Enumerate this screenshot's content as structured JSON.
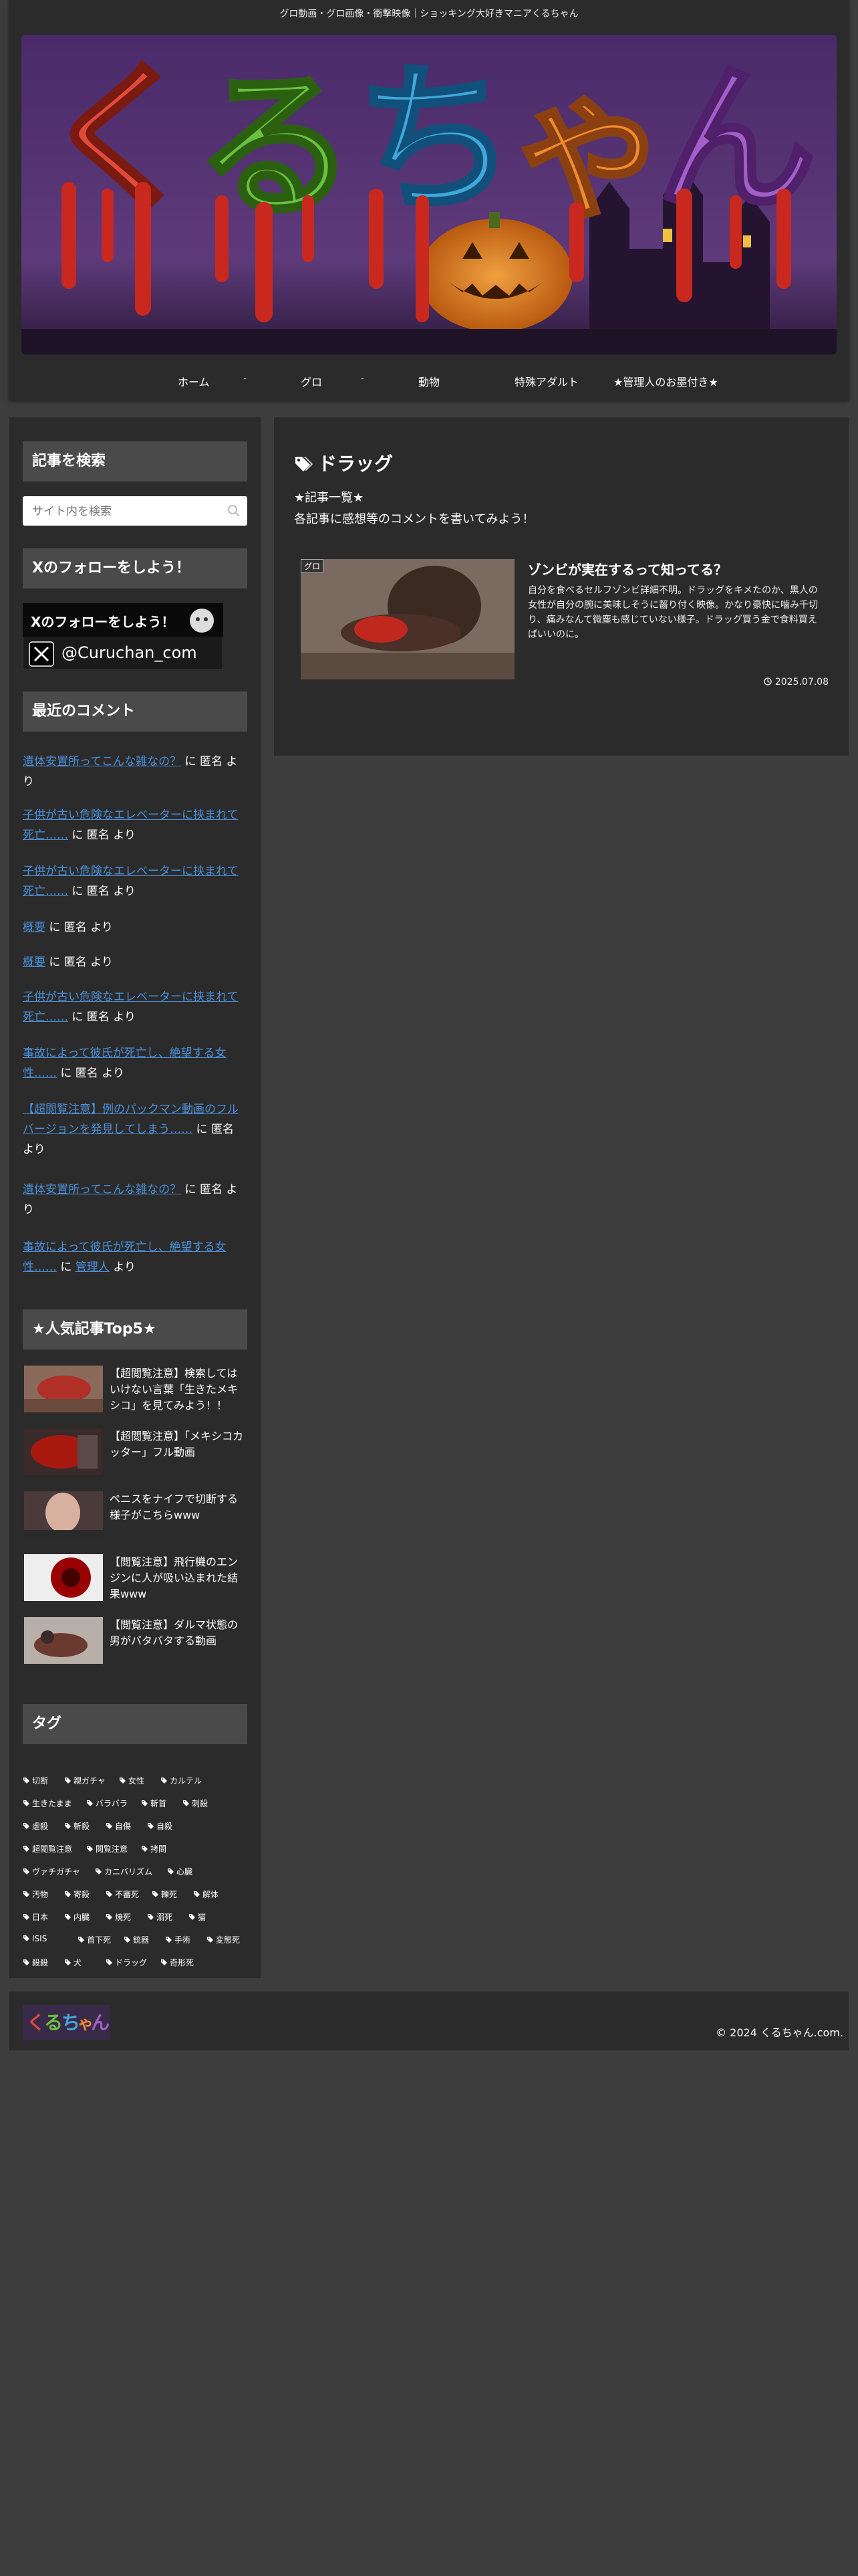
{
  "header": {
    "tagline": "グロ動画・グロ画像・衝撃映像｜ショッキング大好きマニアくるちゃん",
    "logo_text": "くるちゃん",
    "nav": [
      {
        "label": "ホーム"
      },
      {
        "label": "グロ"
      },
      {
        "label": "動物"
      },
      {
        "label": "特殊アダルト"
      },
      {
        "label": "★管理人のお墨付き★"
      }
    ],
    "nav_separator": "-"
  },
  "sidebar": {
    "search": {
      "title": "記事を検索",
      "placeholder": "サイト内を検索"
    },
    "follow": {
      "title": "Xのフォローをしよう！",
      "banner_heading": "Xのフォローをしよう！",
      "banner_handle": "@Curuchan_com"
    },
    "recent_comments": {
      "title": "最近のコメント",
      "items": [
        {
          "link": "遺体安置所ってこんな雑なの？",
          "by": " に 匿名 より",
          "author_link": ""
        },
        {
          "link": "子供が古い危険なエレベーターに挟まれて死亡……",
          "by": " に 匿名 より",
          "author_link": ""
        },
        {
          "link": "子供が古い危険なエレベーターに挟まれて死亡……",
          "by": " に 匿名 より",
          "author_link": ""
        },
        {
          "link": "概要",
          "by": " に 匿名 より",
          "author_link": ""
        },
        {
          "link": "概要",
          "by": " に 匿名 より",
          "author_link": ""
        },
        {
          "link": "子供が古い危険なエレベーターに挟まれて死亡……",
          "by": " に 匿名 より",
          "author_link": ""
        },
        {
          "link": "事故によって彼氏が死亡し、絶望する女性……",
          "by": " に 匿名 より",
          "author_link": ""
        },
        {
          "link": "【超閲覧注意】例のパックマン動画のフルバージョンを発見してしまう……",
          "by": " に 匿名 より",
          "author_link": ""
        },
        {
          "link": "遺体安置所ってこんな雑なの？",
          "by": " に 匿名 より",
          "author_link": ""
        },
        {
          "link": "事故によって彼氏が死亡し、絶望する女性……",
          "by": " に ",
          "author_link": "管理人",
          "by_after": " より"
        }
      ]
    },
    "popular": {
      "title": "★人気記事Top5★",
      "items": [
        {
          "title": "【超閲覧注意】検索してはいけない言葉「生きたメキシコ」を見てみよう！！"
        },
        {
          "title": "【超閲覧注意】「メキシコカッター」フル動画"
        },
        {
          "title": "ペニスをナイフで切断する様子がこちらwww"
        },
        {
          "title": "【閲覧注意】飛行機のエンジンに人が吸い込まれた結果www"
        },
        {
          "title": "【閲覧注意】ダルマ状態の男がバタバタする動画"
        }
      ]
    },
    "tags": {
      "title": "タグ",
      "rows": [
        [
          "切断",
          "親ガチャ",
          "女性",
          "カルテル"
        ],
        [
          "生きたまま",
          "バラバラ",
          "斬首",
          "刺殺"
        ],
        [
          "虐殺",
          "斬殺",
          "自傷",
          "自殺"
        ],
        [
          "超閲覧注意",
          "閲覧注意",
          "拷問"
        ],
        [
          "ヴァチガチャ",
          "カニバリズム",
          "心臓"
        ],
        [
          "汚物",
          "寄殺",
          "不審死",
          "轢死",
          "解体"
        ],
        [
          "日本",
          "内臓",
          "焼死",
          "溺死",
          "猫"
        ],
        [
          "ISIS",
          "首下死",
          "銃器",
          "手術",
          "変態死"
        ],
        [
          "殺殺",
          "犬",
          "ドラッグ",
          "奇形死"
        ]
      ]
    }
  },
  "main": {
    "category_title": "ドラッグ",
    "intro_line1": "★記事一覧★",
    "intro_line2": "各記事に感想等のコメントを書いてみよう！",
    "card": {
      "badge": "グロ",
      "title": "ゾンビが実在するって知ってる？",
      "snippet": "自分を食べるセルフゾンビ詳細不明。ドラッグをキメたのか、黒人の女性が自分の腕に美味しそうに齧り付く映像。かなり豪快に噛み千切り、痛みなんて微塵も感じていない様子。ドラッグ買う金で食料買えばいいのに。",
      "date": "2025.07.08"
    }
  },
  "footer": {
    "copyright": "© 2024 くるちゃん.com."
  },
  "colors": {
    "bg": "#3d3d3d",
    "panel": "#2b2b2b",
    "widget_title": "#4a4a4a",
    "link": "#4a90d9"
  }
}
